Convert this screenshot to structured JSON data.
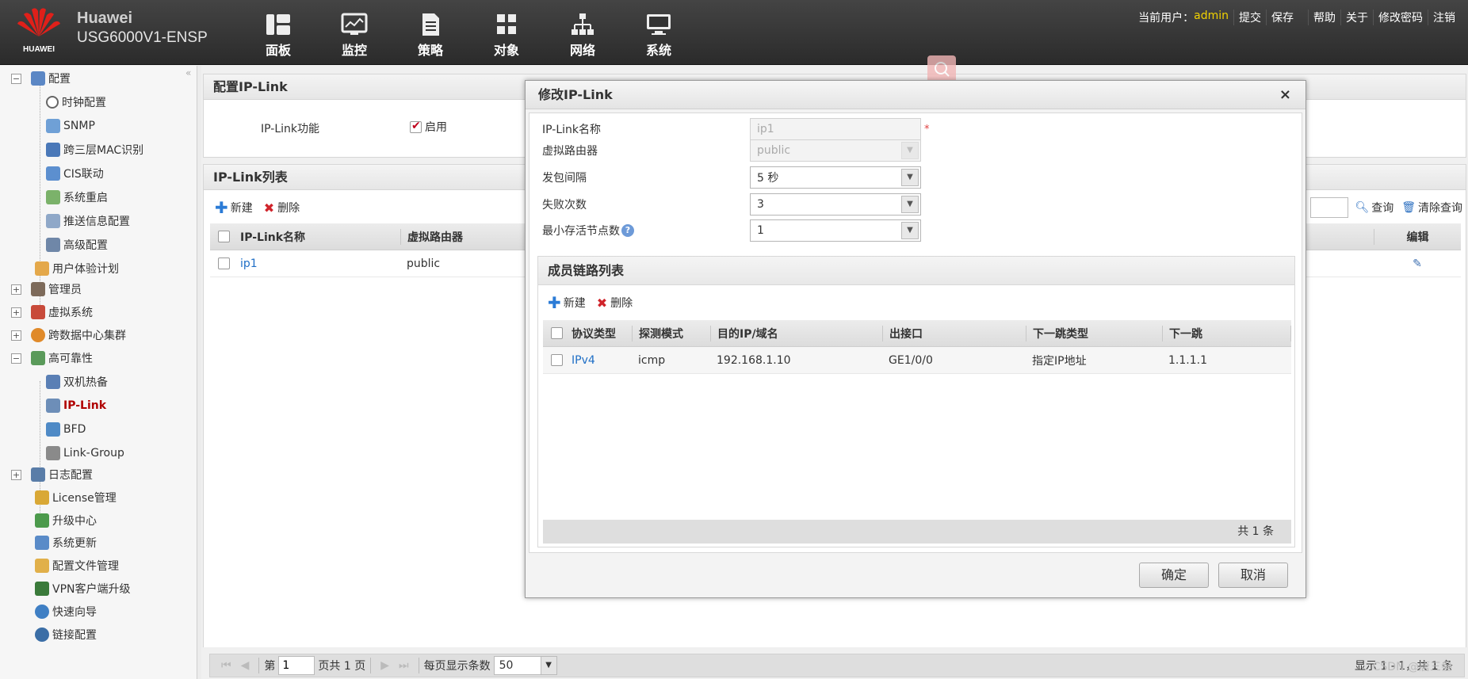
{
  "header": {
    "brand": "HUAWEI",
    "title_line1": "Huawei",
    "title_line2": "USG6000V1-ENSP",
    "nav": [
      {
        "label": "面板",
        "icon": "dashboard-icon"
      },
      {
        "label": "监控",
        "icon": "monitor-icon"
      },
      {
        "label": "策略",
        "icon": "policy-icon"
      },
      {
        "label": "对象",
        "icon": "object-icon"
      },
      {
        "label": "网络",
        "icon": "network-icon"
      },
      {
        "label": "系统",
        "icon": "system-icon"
      }
    ],
    "user_prefix": "当前用户：",
    "user": "admin",
    "links": [
      "提交",
      "保存",
      "帮助",
      "关于",
      "修改密码",
      "注销"
    ]
  },
  "sidebar": {
    "items": [
      {
        "label": "配置"
      },
      {
        "label": "时钟配置"
      },
      {
        "label": "SNMP"
      },
      {
        "label": "跨三层MAC识别"
      },
      {
        "label": "CIS联动"
      },
      {
        "label": "系统重启"
      },
      {
        "label": "推送信息配置"
      },
      {
        "label": "高级配置"
      },
      {
        "label": "用户体验计划"
      },
      {
        "label": "管理员"
      },
      {
        "label": "虚拟系统"
      },
      {
        "label": "跨数据中心集群"
      },
      {
        "label": "高可靠性"
      },
      {
        "label": "双机热备"
      },
      {
        "label": "IP-Link"
      },
      {
        "label": "BFD"
      },
      {
        "label": "Link-Group"
      },
      {
        "label": "日志配置"
      },
      {
        "label": "License管理"
      },
      {
        "label": "升级中心"
      },
      {
        "label": "系统更新"
      },
      {
        "label": "配置文件管理"
      },
      {
        "label": "VPN客户端升级"
      },
      {
        "label": "快速向导"
      },
      {
        "label": "链接配置"
      }
    ]
  },
  "config_panel": {
    "title": "配置IP-Link",
    "feature_label": "IP-Link功能",
    "enable_label": "启用"
  },
  "list_panel": {
    "title": "IP-Link列表",
    "new_label": "新建",
    "delete_label": "删除",
    "search_label": "查询",
    "clear_search_label": "清除查询",
    "columns": {
      "name": "IP-Link名称",
      "vr": "虚拟路由器",
      "edit": "编辑"
    },
    "rows": [
      {
        "name": "ip1",
        "vr": "public"
      }
    ]
  },
  "pager": {
    "page_prefix": "第",
    "page_value": "1",
    "page_suffix": "页共 1 页",
    "per_page_label": "每页显示条数",
    "per_page_value": "50",
    "display_text": "显示 1 - 1，共 1 条"
  },
  "modal": {
    "title": "修改IP-Link",
    "close": "×",
    "fields": {
      "name_label": "IP-Link名称",
      "name_value": "ip1",
      "name_required": "*",
      "vr_label": "虚拟路由器",
      "vr_value": "public",
      "interval_label": "发包间隔",
      "interval_value": "5 秒",
      "fail_label": "失败次数",
      "fail_value": "3",
      "min_label": "最小存活节点数",
      "min_value": "1",
      "help": "?"
    },
    "member": {
      "title": "成员链路列表",
      "new_label": "新建",
      "delete_label": "删除",
      "columns": {
        "protocol": "协议类型",
        "mode": "探测模式",
        "dest": "目的IP/域名",
        "out": "出接口",
        "nexthop_type": "下一跳类型",
        "nexthop": "下一跳"
      },
      "rows": [
        {
          "protocol": "IPv4",
          "mode": "icmp",
          "dest": "192.168.1.10",
          "out": "GE1/0/0",
          "nexthop_type": "指定IP地址",
          "nexthop": "1.1.1.1"
        }
      ],
      "total": "共 1 条"
    },
    "ok": "确定",
    "cancel": "取消"
  },
  "watermark": "CSDN @唐三叁",
  "colors": {
    "accent_red": "#c0001c",
    "link_blue": "#1f6fc6",
    "user_yellow": "#f2d300"
  }
}
